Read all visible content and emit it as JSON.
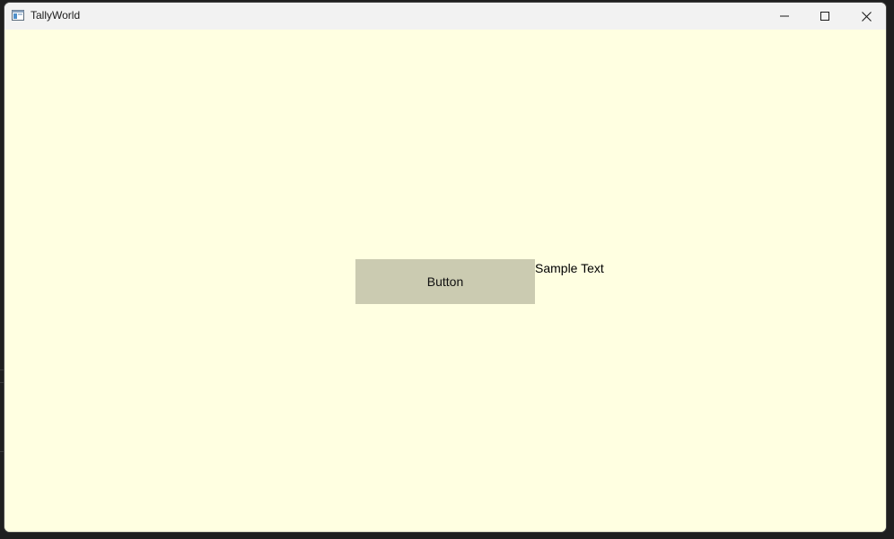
{
  "window": {
    "title": "TallyWorld",
    "app_icon": "window-app-icon",
    "controls": {
      "minimize": "minimize-icon",
      "maximize": "maximize-icon",
      "close": "close-icon"
    },
    "client_background": "#ffffe1"
  },
  "content": {
    "button_label": "Button",
    "sample_text": "Sample Text",
    "button_color": "#cbcbb1"
  }
}
